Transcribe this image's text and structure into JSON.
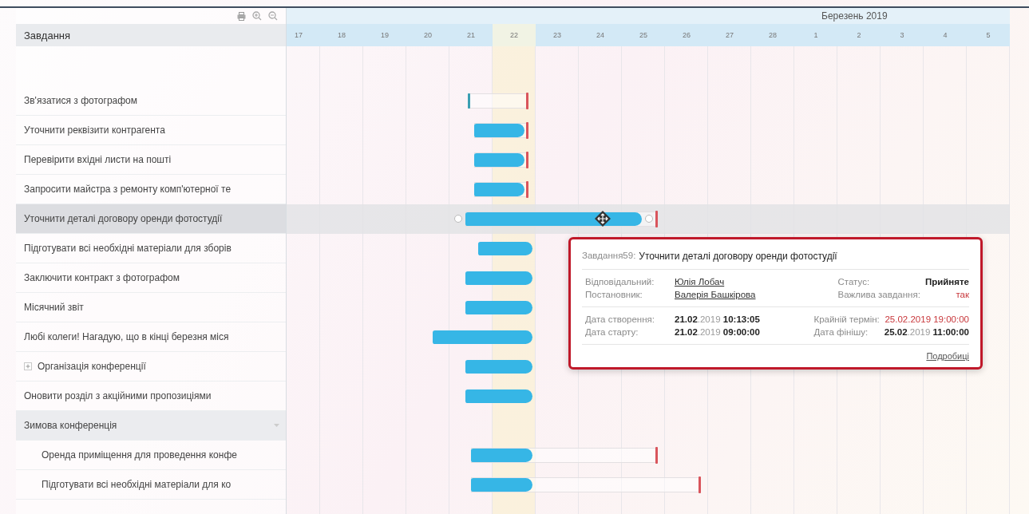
{
  "toolbar": {
    "title": "Завдання"
  },
  "timeline": {
    "months": [
      {
        "days": [
          {
            "label": "17",
            "today": false
          },
          {
            "label": "18",
            "today": false
          },
          {
            "label": "19",
            "today": false
          },
          {
            "label": "20",
            "today": false
          },
          {
            "label": "21",
            "today": false
          },
          {
            "label": "22",
            "today": true
          },
          {
            "label": "23",
            "today": false
          },
          {
            "label": "24",
            "today": false
          },
          {
            "label": "25",
            "today": false
          },
          {
            "label": "26",
            "today": false
          },
          {
            "label": "27",
            "today": false
          },
          {
            "label": "28",
            "today": false
          }
        ]
      },
      {
        "label": "Березень 2019",
        "days": [
          {
            "label": "1",
            "today": false
          },
          {
            "label": "2",
            "today": false
          },
          {
            "label": "3",
            "today": false
          },
          {
            "label": "4",
            "today": false
          },
          {
            "label": "5",
            "today": false
          }
        ]
      }
    ]
  },
  "tasks": [
    {
      "kind": "task",
      "name": "Зв'язатися з фотографом",
      "selected": false
    },
    {
      "kind": "task",
      "name": "Уточнити реквізити контрагента",
      "selected": false
    },
    {
      "kind": "task",
      "name": "Перевірити вхідні листи на пошті",
      "selected": false
    },
    {
      "kind": "task",
      "name": "Запросити майстра з ремонту комп'ютерної те",
      "selected": false
    },
    {
      "kind": "task",
      "name": "Уточнити деталі договору оренди фотостудії",
      "selected": true
    },
    {
      "kind": "task",
      "name": "Підготувати всі необхідні матеріали для зборів",
      "selected": false
    },
    {
      "kind": "task",
      "name": "Заключити контракт з фотографом",
      "selected": false
    },
    {
      "kind": "task",
      "name": "Місячний звіт",
      "selected": false
    },
    {
      "kind": "task",
      "name": "Любі колеги! Нагадую, що в кінці березня міся",
      "selected": false
    },
    {
      "kind": "group",
      "name": "Організація конференції",
      "selected": false,
      "expanded": false
    },
    {
      "kind": "task",
      "name": "Оновити розділ з акційними пропозиціями",
      "selected": false
    },
    {
      "kind": "group",
      "name": "Зимова конференція",
      "selected": false,
      "expanded": true,
      "children": [
        {
          "name": "Оренда приміщення для проведення конфе",
          "selected": false
        },
        {
          "name": "Підготувати всі необхідні матеріали для ко",
          "selected": false
        }
      ]
    }
  ],
  "tooltip": {
    "prefix": "Завдання59:",
    "title": "Уточнити деталі договору оренди фотостудії",
    "people": [
      {
        "label": "Відповідальний:",
        "value": "Юлія Лобач",
        "kind": "link"
      },
      {
        "label": "Статус:",
        "value": "Прийняте",
        "kind": "bold"
      },
      {
        "label": "Постановник:",
        "value": "Валерія Башкірова",
        "kind": "link"
      },
      {
        "label": "Важлива завдання:",
        "value": "так",
        "kind": "alert"
      }
    ],
    "dates": [
      {
        "label": "Дата створення:",
        "value": "**21.02**.2019 **10:13:05**",
        "kind": "date"
      },
      {
        "label": "Крайній термін:",
        "value": "25.02.2019 19:00:00",
        "kind": "alert"
      },
      {
        "label": "Дата старту:",
        "value": "**21.02**.2019 **09:00:00**",
        "kind": "date"
      },
      {
        "label": "Дата фінішу:",
        "value": "**25.02**.2019 **11:00:00**",
        "kind": "date"
      }
    ],
    "link": "Подробиці"
  }
}
